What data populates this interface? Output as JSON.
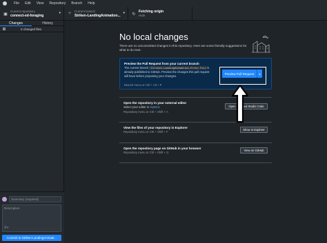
{
  "menubar": {
    "items": [
      "File",
      "Edit",
      "View",
      "Repository",
      "Branch",
      "Help"
    ]
  },
  "toolbar": {
    "repo_label": "Current repository",
    "repo_value": "connect-ed-foraging",
    "branch_label": "Current branch",
    "branch_value": "Striken-LandingAnimation...",
    "fetch_label": "Fetching origin",
    "fetch_value": "Hide"
  },
  "sidebar": {
    "tabs": [
      "Changes",
      "History"
    ],
    "changed_files": "0 changed files",
    "summary_placeholder": "Summary (required)",
    "description_placeholder": "Description",
    "commit_button": "Commit to Striken-LandingAnimati..."
  },
  "main": {
    "title": "No local changes",
    "subtitle": "There are no uncommitted changes in this repository. Here are some friendly suggestions for what to do next.",
    "preview": {
      "title": "Preview the Pull Request from your current branch",
      "desc_pre": "The current branch (",
      "branch_code": "Striken-LandingAnimation-Error-Fix",
      "desc_post": ") is already published to GitHub. Preview the changes this pull request will have before proposing your changes.",
      "hint": "Branch menu or  Ctrl + Alt + P",
      "button": "Preview Pull Request",
      "split_icon": "chevron-down-icon"
    },
    "editor": {
      "title": "Open the repository in your external editor",
      "desc_pre": "Select your editor in ",
      "desc_link": "Options",
      "hint": "Repository menu or  Ctrl + Shift + A",
      "button": "Open in Visual Studio Code"
    },
    "explorer": {
      "title": "View the files of your repository in Explorer",
      "hint": "Repository menu or  Ctrl + Shift + F",
      "button": "Show in Explorer"
    },
    "github": {
      "title": "Open the repository page on GitHub in your browser",
      "hint": "Repository menu or  Ctrl + Shift + G",
      "button": "View on GitHub"
    }
  },
  "colors": {
    "accent": "#2188ff",
    "highlight_card": "#0a2a4a",
    "background": "#24292e"
  }
}
